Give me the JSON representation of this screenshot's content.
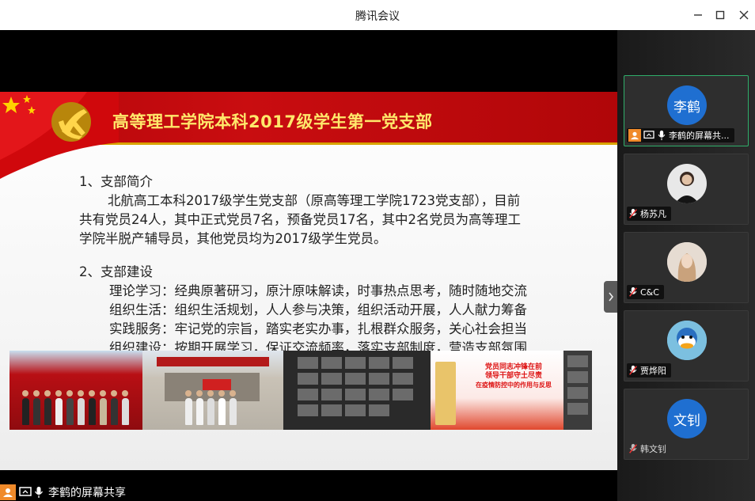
{
  "window": {
    "title": "腾讯会议"
  },
  "slide": {
    "title": "高等理工学院本科2017级学生第一党支部",
    "section1_heading": "1、支部简介",
    "section1_lines": [
      "北航高工本科2017级学生党支部（原高等理工学院1723党支部），目前",
      "共有党员24人，其中正式党员7名，预备党员17名，其中2名党员为高等理工",
      "学院半脱产辅导员，其他党员均为2017级学生党员。"
    ],
    "section2_heading": "2、支部建设",
    "section2_lines": [
      "理论学习：经典原著研习，原汁原味解读，时事热点思考，随时随地交流",
      "组织生活：组织生活规划，人人参与决策，组织活动开展，人人献力筹备",
      "实践服务：牢记党的宗旨，踏实老实办事，扎根群众服务，关心社会担当",
      "组织建设：按期开展学习，保证交流频率，落实支部制度，营造支部氛围"
    ],
    "photo4_text": [
      "党员同志冲锋在前",
      "领导干部守土尽责",
      "在疫情防控中的作用与反思"
    ]
  },
  "share_status": {
    "label": "李鹤的屏幕共享"
  },
  "participants": [
    {
      "avatar_text": "李鹤",
      "name": "李鹤的屏幕共...",
      "avatar_color": "#1f6fd1",
      "active": true
    },
    {
      "avatar_text": "",
      "name": "杨苏凡",
      "avatar_color": "#e8e8e8",
      "active": false
    },
    {
      "avatar_text": "",
      "name": "C&C",
      "avatar_color": "#d8cfc8",
      "active": false
    },
    {
      "avatar_text": "",
      "name": "贾烨阳",
      "avatar_color": "#6fb6d8",
      "active": false
    },
    {
      "avatar_text": "文钊",
      "name": "韩文钊",
      "avatar_color": "#1f6fd1",
      "active": false
    }
  ],
  "colors": {
    "accent_green": "#2fae6a",
    "banner_red": "#c90d10",
    "title_yellow": "#ffe86b",
    "avatar_blue": "#1f6fd1",
    "host_orange": "#f08a2a"
  }
}
